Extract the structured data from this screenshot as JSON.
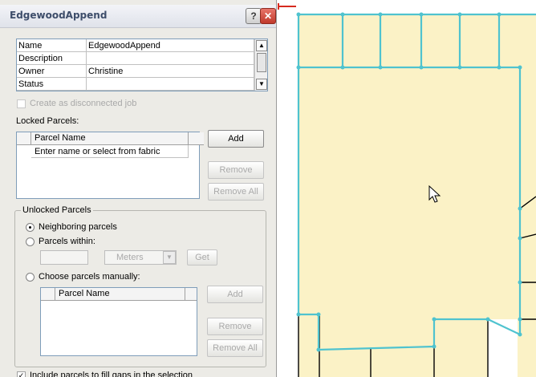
{
  "dialog": {
    "title": "EdgewoodAppend",
    "help_glyph": "?",
    "close_glyph": "✕",
    "properties": [
      {
        "key": "Name",
        "value": "EdgewoodAppend"
      },
      {
        "key": "Description",
        "value": ""
      },
      {
        "key": "Owner",
        "value": "Christine"
      },
      {
        "key": "Status",
        "value": ""
      }
    ],
    "create_disconnected_label": "Create as disconnected job",
    "locked_parcels_label": "Locked Parcels:",
    "locked_list": {
      "column": "Parcel Name",
      "placeholder_row": "Enter name or select from fabric"
    },
    "buttons": {
      "add": "Add",
      "remove": "Remove",
      "remove_all": "Remove All"
    },
    "unlocked": {
      "title": "Unlocked Parcels",
      "neighboring": "Neighboring parcels",
      "within": "Parcels within:",
      "units": "Meters",
      "get": "Get",
      "manual": "Choose parcels manually:",
      "column": "Parcel Name",
      "add": "Add",
      "remove": "Remove",
      "remove_all": "Remove All"
    },
    "fill_gaps_label": "Include parcels to fill gaps in the selection"
  },
  "map": {
    "fill_color": "#fbf2c6",
    "selection_color": "#4fc3cf",
    "line_color": "#000000"
  }
}
